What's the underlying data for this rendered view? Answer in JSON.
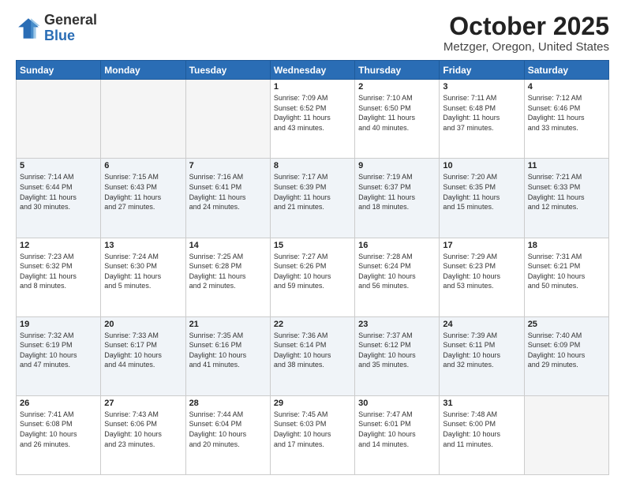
{
  "header": {
    "logo_general": "General",
    "logo_blue": "Blue",
    "title": "October 2025",
    "subtitle": "Metzger, Oregon, United States"
  },
  "days_of_week": [
    "Sunday",
    "Monday",
    "Tuesday",
    "Wednesday",
    "Thursday",
    "Friday",
    "Saturday"
  ],
  "weeks": [
    [
      {
        "num": "",
        "info": ""
      },
      {
        "num": "",
        "info": ""
      },
      {
        "num": "",
        "info": ""
      },
      {
        "num": "1",
        "info": "Sunrise: 7:09 AM\nSunset: 6:52 PM\nDaylight: 11 hours\nand 43 minutes."
      },
      {
        "num": "2",
        "info": "Sunrise: 7:10 AM\nSunset: 6:50 PM\nDaylight: 11 hours\nand 40 minutes."
      },
      {
        "num": "3",
        "info": "Sunrise: 7:11 AM\nSunset: 6:48 PM\nDaylight: 11 hours\nand 37 minutes."
      },
      {
        "num": "4",
        "info": "Sunrise: 7:12 AM\nSunset: 6:46 PM\nDaylight: 11 hours\nand 33 minutes."
      }
    ],
    [
      {
        "num": "5",
        "info": "Sunrise: 7:14 AM\nSunset: 6:44 PM\nDaylight: 11 hours\nand 30 minutes."
      },
      {
        "num": "6",
        "info": "Sunrise: 7:15 AM\nSunset: 6:43 PM\nDaylight: 11 hours\nand 27 minutes."
      },
      {
        "num": "7",
        "info": "Sunrise: 7:16 AM\nSunset: 6:41 PM\nDaylight: 11 hours\nand 24 minutes."
      },
      {
        "num": "8",
        "info": "Sunrise: 7:17 AM\nSunset: 6:39 PM\nDaylight: 11 hours\nand 21 minutes."
      },
      {
        "num": "9",
        "info": "Sunrise: 7:19 AM\nSunset: 6:37 PM\nDaylight: 11 hours\nand 18 minutes."
      },
      {
        "num": "10",
        "info": "Sunrise: 7:20 AM\nSunset: 6:35 PM\nDaylight: 11 hours\nand 15 minutes."
      },
      {
        "num": "11",
        "info": "Sunrise: 7:21 AM\nSunset: 6:33 PM\nDaylight: 11 hours\nand 12 minutes."
      }
    ],
    [
      {
        "num": "12",
        "info": "Sunrise: 7:23 AM\nSunset: 6:32 PM\nDaylight: 11 hours\nand 8 minutes."
      },
      {
        "num": "13",
        "info": "Sunrise: 7:24 AM\nSunset: 6:30 PM\nDaylight: 11 hours\nand 5 minutes."
      },
      {
        "num": "14",
        "info": "Sunrise: 7:25 AM\nSunset: 6:28 PM\nDaylight: 11 hours\nand 2 minutes."
      },
      {
        "num": "15",
        "info": "Sunrise: 7:27 AM\nSunset: 6:26 PM\nDaylight: 10 hours\nand 59 minutes."
      },
      {
        "num": "16",
        "info": "Sunrise: 7:28 AM\nSunset: 6:24 PM\nDaylight: 10 hours\nand 56 minutes."
      },
      {
        "num": "17",
        "info": "Sunrise: 7:29 AM\nSunset: 6:23 PM\nDaylight: 10 hours\nand 53 minutes."
      },
      {
        "num": "18",
        "info": "Sunrise: 7:31 AM\nSunset: 6:21 PM\nDaylight: 10 hours\nand 50 minutes."
      }
    ],
    [
      {
        "num": "19",
        "info": "Sunrise: 7:32 AM\nSunset: 6:19 PM\nDaylight: 10 hours\nand 47 minutes."
      },
      {
        "num": "20",
        "info": "Sunrise: 7:33 AM\nSunset: 6:17 PM\nDaylight: 10 hours\nand 44 minutes."
      },
      {
        "num": "21",
        "info": "Sunrise: 7:35 AM\nSunset: 6:16 PM\nDaylight: 10 hours\nand 41 minutes."
      },
      {
        "num": "22",
        "info": "Sunrise: 7:36 AM\nSunset: 6:14 PM\nDaylight: 10 hours\nand 38 minutes."
      },
      {
        "num": "23",
        "info": "Sunrise: 7:37 AM\nSunset: 6:12 PM\nDaylight: 10 hours\nand 35 minutes."
      },
      {
        "num": "24",
        "info": "Sunrise: 7:39 AM\nSunset: 6:11 PM\nDaylight: 10 hours\nand 32 minutes."
      },
      {
        "num": "25",
        "info": "Sunrise: 7:40 AM\nSunset: 6:09 PM\nDaylight: 10 hours\nand 29 minutes."
      }
    ],
    [
      {
        "num": "26",
        "info": "Sunrise: 7:41 AM\nSunset: 6:08 PM\nDaylight: 10 hours\nand 26 minutes."
      },
      {
        "num": "27",
        "info": "Sunrise: 7:43 AM\nSunset: 6:06 PM\nDaylight: 10 hours\nand 23 minutes."
      },
      {
        "num": "28",
        "info": "Sunrise: 7:44 AM\nSunset: 6:04 PM\nDaylight: 10 hours\nand 20 minutes."
      },
      {
        "num": "29",
        "info": "Sunrise: 7:45 AM\nSunset: 6:03 PM\nDaylight: 10 hours\nand 17 minutes."
      },
      {
        "num": "30",
        "info": "Sunrise: 7:47 AM\nSunset: 6:01 PM\nDaylight: 10 hours\nand 14 minutes."
      },
      {
        "num": "31",
        "info": "Sunrise: 7:48 AM\nSunset: 6:00 PM\nDaylight: 10 hours\nand 11 minutes."
      },
      {
        "num": "",
        "info": ""
      }
    ]
  ]
}
